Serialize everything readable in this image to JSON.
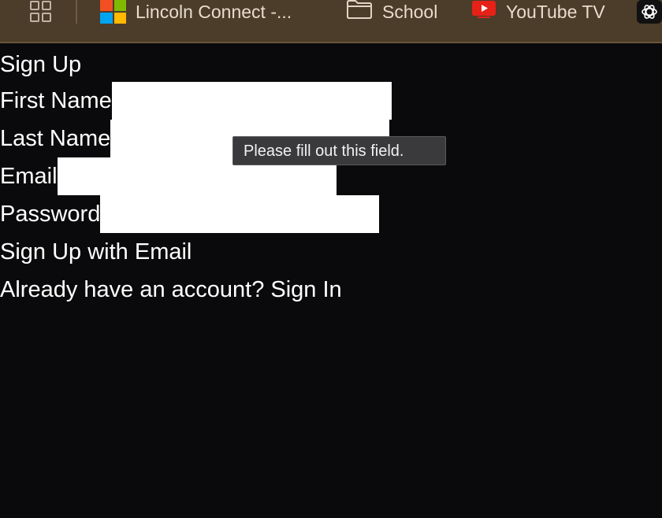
{
  "bookmarks": {
    "items": [
      {
        "label": "Lincoln Connect -...",
        "icon": "microsoft-icon"
      },
      {
        "label": "School",
        "icon": "folder-icon"
      },
      {
        "label": "YouTube TV",
        "icon": "youtube-tv-icon"
      }
    ],
    "apps_icon": "apps-grid-icon",
    "trailing_icon": "openai-icon"
  },
  "form": {
    "title": "Sign Up",
    "first_name_label": "First Name",
    "last_name_label": "Last Name",
    "email_label": "Email",
    "password_label": "Password",
    "first_name_value": "",
    "last_name_value": "",
    "email_value": "",
    "password_value": "",
    "submit_label": "Sign Up with Email",
    "signin_prompt": "Already have an account? Sign In"
  },
  "tooltip": {
    "text": "Please fill out this field."
  },
  "colors": {
    "background": "#0a0a0c",
    "bookmarks_bar": "#4c3c2a",
    "text": "#ffffff",
    "tooltip_bg": "#3a3a3c"
  }
}
